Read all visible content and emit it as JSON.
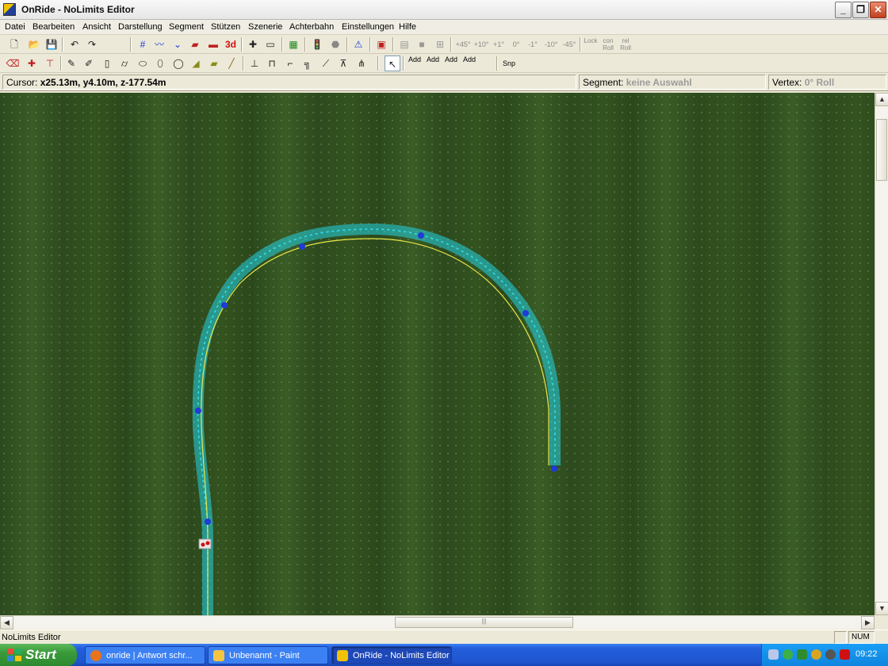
{
  "window": {
    "title": "OnRide - NoLimits Editor",
    "controls": {
      "minimize": "_",
      "maximize": "❐",
      "close": "✕"
    }
  },
  "menu": [
    "Datei",
    "Bearbeiten",
    "Ansicht",
    "Darstellung",
    "Segment",
    "Stützen",
    "Szenerie",
    "Achterbahn",
    "Einstellungen",
    "Hilfe"
  ],
  "toolbar1": {
    "items": [
      {
        "name": "new-file-icon",
        "glyph": "🗋"
      },
      {
        "name": "open-folder-icon",
        "glyph": "📂"
      },
      {
        "name": "save-icon",
        "glyph": "💾"
      },
      {
        "name": "undo-icon",
        "glyph": "↶"
      },
      {
        "name": "redo-icon",
        "glyph": "↷"
      },
      {
        "name": "grid-icon",
        "glyph": "#"
      },
      {
        "name": "track-view-icon",
        "glyph": "〰"
      },
      {
        "name": "curve-view-icon",
        "glyph": "⌄"
      },
      {
        "name": "station-icon",
        "glyph": "▰"
      },
      {
        "name": "train-icon",
        "glyph": "▬"
      },
      {
        "name": "3d-view-icon",
        "glyph": "3d"
      },
      {
        "name": "insert-segment-icon",
        "glyph": "✚"
      },
      {
        "name": "remove-segment-icon",
        "glyph": "▭"
      },
      {
        "name": "terrain-icon",
        "glyph": "▦"
      },
      {
        "name": "traffic-light-icon",
        "glyph": "🚦"
      },
      {
        "name": "stop-sign-icon",
        "glyph": "⬣"
      },
      {
        "name": "warning-icon",
        "glyph": "⚠"
      },
      {
        "name": "brake-icon",
        "glyph": "▣"
      },
      {
        "name": "panel-icon",
        "glyph": "▤"
      },
      {
        "name": "block-icon",
        "glyph": "■"
      },
      {
        "name": "align-icon",
        "glyph": "⊞"
      }
    ],
    "roll_buttons": [
      "+45°",
      "+10°",
      "+1°",
      "0°",
      "-1°",
      "-10°",
      "-45°"
    ],
    "lock_buttons": [
      "Lock",
      "con Roll",
      "rel Roll"
    ]
  },
  "toolbar2": {
    "items": [
      {
        "name": "eraser-icon",
        "glyph": "⌫"
      },
      {
        "name": "cross-marker-icon",
        "glyph": "✚"
      },
      {
        "name": "junction-icon",
        "glyph": "⊤"
      },
      {
        "name": "pencil-icon",
        "glyph": "✎"
      },
      {
        "name": "double-pencil-icon",
        "glyph": "✐"
      },
      {
        "name": "pillar-icon",
        "glyph": "▯"
      },
      {
        "name": "cylinder-icon",
        "glyph": "⌭"
      },
      {
        "name": "cylinder-h-icon",
        "glyph": "⬭"
      },
      {
        "name": "cylinder-2-icon",
        "glyph": "⬯"
      },
      {
        "name": "cylinder-3-icon",
        "glyph": "◯"
      },
      {
        "name": "ramp-icon",
        "glyph": "◢"
      },
      {
        "name": "box-icon",
        "glyph": "▰"
      },
      {
        "name": "beam-icon",
        "glyph": "╱"
      },
      {
        "name": "support-a-icon",
        "glyph": "⊥"
      },
      {
        "name": "support-b-icon",
        "glyph": "⊓"
      },
      {
        "name": "support-c-icon",
        "glyph": "⌐"
      },
      {
        "name": "support-d-icon",
        "glyph": "╗"
      },
      {
        "name": "support-e-icon",
        "glyph": "⟋"
      },
      {
        "name": "support-f-icon",
        "glyph": "⊼"
      },
      {
        "name": "support-g-icon",
        "glyph": "⋔"
      },
      {
        "name": "pointer-icon",
        "glyph": "↖"
      }
    ],
    "add_buttons": [
      "Add",
      "Add",
      "Add",
      "Add"
    ],
    "snap_label": "Snp"
  },
  "info": {
    "cursor_label": "Cursor:",
    "cursor_value": "x25.13m, y4.10m, z-177.54m",
    "segment_label": "Segment:",
    "segment_value": "keine Auswahl",
    "vertex_label": "Vertex:",
    "vertex_value": "0° Roll"
  },
  "colors": {
    "track_outer": "#22d3e6",
    "track_center": "#e8e84a",
    "vertex": "#1f3bd8",
    "terrain": "#2f4f1f"
  },
  "statusbar": {
    "text": "NoLimits Editor",
    "panel_num": "NUM"
  },
  "taskbar": {
    "start": "Start",
    "tasks": [
      {
        "label": "onride | Antwort schr...",
        "icon_color": "#e8731a"
      },
      {
        "label": "Unbenannt - Paint",
        "icon_color": "#f4c542"
      },
      {
        "label": "OnRide - NoLimits Editor",
        "icon_color": "#f2c200"
      }
    ],
    "clock": "09:22"
  },
  "scroll": {
    "thumb_label": "|||"
  }
}
